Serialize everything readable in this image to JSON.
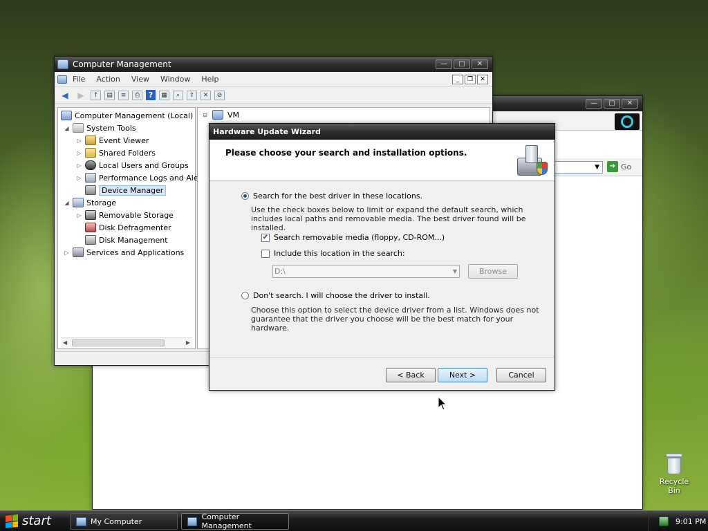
{
  "desktop": {
    "recycle_bin_label": "Recycle Bin"
  },
  "back_window": {
    "go_label": "Go"
  },
  "computer_management": {
    "title": "Computer Management",
    "menu": [
      "File",
      "Action",
      "View",
      "Window",
      "Help"
    ],
    "tree": {
      "root": "Computer Management (Local)",
      "system_tools": "System Tools",
      "event_viewer": "Event Viewer",
      "shared_folders": "Shared Folders",
      "local_users": "Local Users and Groups",
      "perf_logs": "Performance Logs and Alert",
      "device_manager": "Device Manager",
      "storage": "Storage",
      "removable_storage": "Removable Storage",
      "disk_defrag": "Disk Defragmenter",
      "disk_management": "Disk Management",
      "services_apps": "Services and Applications"
    },
    "right_pane_root": "VM"
  },
  "wizard": {
    "title": "Hardware Update Wizard",
    "heading": "Please choose your search and installation options.",
    "option_search": "Search for the best driver in these locations.",
    "option_search_desc": "Use the check boxes below to limit or expand the default search, which includes local paths and removable media. The best driver found will be installed.",
    "check_removable": "Search removable media (floppy, CD-ROM...)",
    "check_include": "Include this location in the search:",
    "location_value": "D:\\",
    "browse_label": "Browse",
    "option_dont_search": "Don't search. I will choose the driver to install.",
    "option_dont_search_desc": "Choose this option to select the device driver from a list. Windows does not guarantee that the driver you choose will be the best match for your hardware.",
    "back_label": "< Back",
    "next_label": "Next >",
    "cancel_label": "Cancel"
  },
  "taskbar": {
    "start_label": "start",
    "tasks": [
      "My Computer",
      "Computer Management"
    ],
    "clock": "9:01 PM"
  }
}
